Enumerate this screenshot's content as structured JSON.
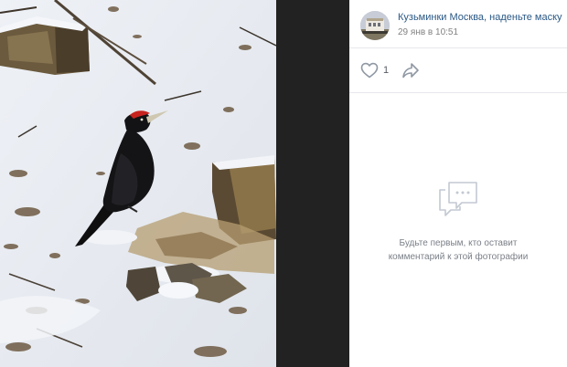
{
  "post": {
    "author_name": "Кузьминки Москва, наденьте маску",
    "date": "29 янв в 10:51",
    "avatar_icon": "community-avatar"
  },
  "actions": {
    "like_icon": "heart-icon",
    "like_count": "1",
    "share_icon": "share-arrow-icon"
  },
  "comments": {
    "empty_icon": "comments-bubble-icon",
    "empty_line1": "Будьте первым, кто оставит",
    "empty_line2": "комментарий к этой фотографии"
  },
  "colors": {
    "link": "#2a5885",
    "muted": "#828282",
    "icon": "#99a2ad",
    "panel_bg": "#ffffff",
    "gutter": "#222222"
  }
}
